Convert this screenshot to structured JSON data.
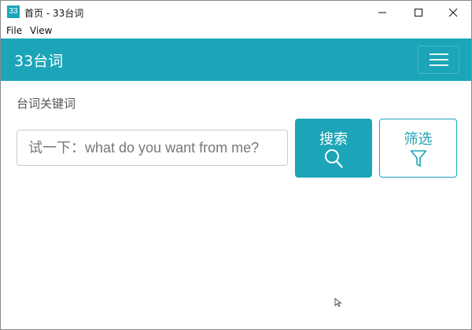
{
  "window": {
    "icon_text": "33",
    "title": "首页 - 33台词"
  },
  "menu": {
    "file": "File",
    "view": "View"
  },
  "header": {
    "brand": "33台词",
    "bg_color": "#1ca5b8"
  },
  "search": {
    "section_label": "台词关键词",
    "input_value": "",
    "input_placeholder": "试一下：what do you want from me?",
    "search_button_label": "搜索",
    "search_button_icon": "search-icon",
    "filter_button_label": "筛选",
    "filter_button_icon": "filter-icon"
  },
  "colors": {
    "accent": "#1ca5b8",
    "text_muted": "#555555",
    "border": "#cccccc"
  }
}
